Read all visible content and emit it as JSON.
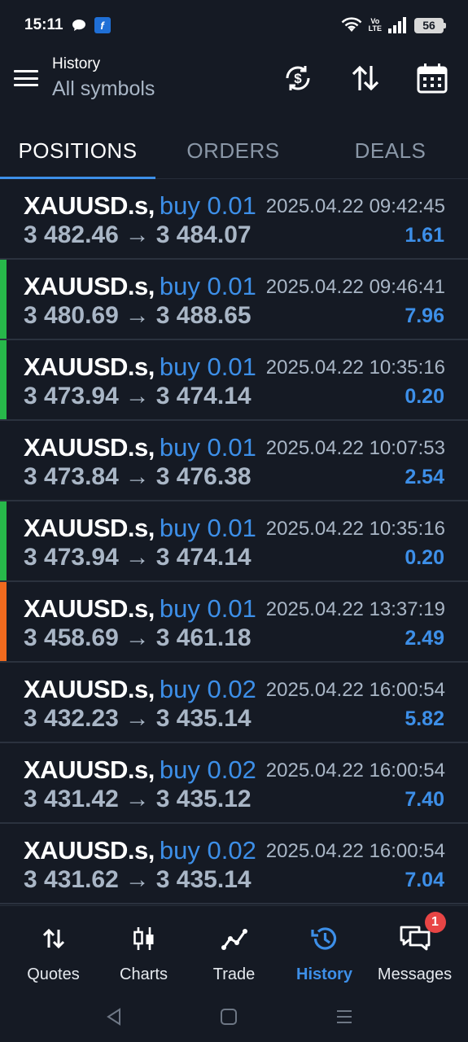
{
  "status_bar": {
    "time": "15:11",
    "app_badge": "f",
    "battery": "56",
    "network": "Vo LTE"
  },
  "header": {
    "title": "History",
    "subtitle": "All symbols"
  },
  "tabs": [
    {
      "label": "POSITIONS",
      "active": true
    },
    {
      "label": "ORDERS",
      "active": false
    },
    {
      "label": "DEALS",
      "active": false
    }
  ],
  "arrow": "→",
  "colors": {
    "accent": "#3d8fe8",
    "green_marker": "#27b84a",
    "orange_marker": "#f06a1e",
    "background": "#151a24"
  },
  "positions": [
    {
      "symbol": "XAUUSD.s,",
      "side": "buy 0.01",
      "open_price": "3 482.46",
      "close_price": "3 484.07",
      "datetime": "2025.04.22 09:42:45",
      "profit": "1.61",
      "marker": "none"
    },
    {
      "symbol": "XAUUSD.s,",
      "side": "buy 0.01",
      "open_price": "3 480.69",
      "close_price": "3 488.65",
      "datetime": "2025.04.22 09:46:41",
      "profit": "7.96",
      "marker": "green"
    },
    {
      "symbol": "XAUUSD.s,",
      "side": "buy 0.01",
      "open_price": "3 473.94",
      "close_price": "3 474.14",
      "datetime": "2025.04.22 10:35:16",
      "profit": "0.20",
      "marker": "green"
    },
    {
      "symbol": "XAUUSD.s,",
      "side": "buy 0.01",
      "open_price": "3 473.84",
      "close_price": "3 476.38",
      "datetime": "2025.04.22 10:07:53",
      "profit": "2.54",
      "marker": "none"
    },
    {
      "symbol": "XAUUSD.s,",
      "side": "buy 0.01",
      "open_price": "3 473.94",
      "close_price": "3 474.14",
      "datetime": "2025.04.22 10:35:16",
      "profit": "0.20",
      "marker": "green"
    },
    {
      "symbol": "XAUUSD.s,",
      "side": "buy 0.01",
      "open_price": "3 458.69",
      "close_price": "3 461.18",
      "datetime": "2025.04.22 13:37:19",
      "profit": "2.49",
      "marker": "orange"
    },
    {
      "symbol": "XAUUSD.s,",
      "side": "buy 0.02",
      "open_price": "3 432.23",
      "close_price": "3 435.14",
      "datetime": "2025.04.22 16:00:54",
      "profit": "5.82",
      "marker": "none"
    },
    {
      "symbol": "XAUUSD.s,",
      "side": "buy 0.02",
      "open_price": "3 431.42",
      "close_price": "3 435.12",
      "datetime": "2025.04.22 16:00:54",
      "profit": "7.40",
      "marker": "none"
    },
    {
      "symbol": "XAUUSD.s,",
      "side": "buy 0.02",
      "open_price": "3 431.62",
      "close_price": "3 435.14",
      "datetime": "2025.04.22 16:00:54",
      "profit": "7.04",
      "marker": "none"
    }
  ],
  "bottom_nav": [
    {
      "label": "Quotes",
      "icon": "quotes-icon",
      "active": false
    },
    {
      "label": "Charts",
      "icon": "charts-icon",
      "active": false
    },
    {
      "label": "Trade",
      "icon": "trade-icon",
      "active": false
    },
    {
      "label": "History",
      "icon": "history-icon",
      "active": true
    },
    {
      "label": "Messages",
      "icon": "messages-icon",
      "active": false,
      "badge": "1"
    }
  ]
}
